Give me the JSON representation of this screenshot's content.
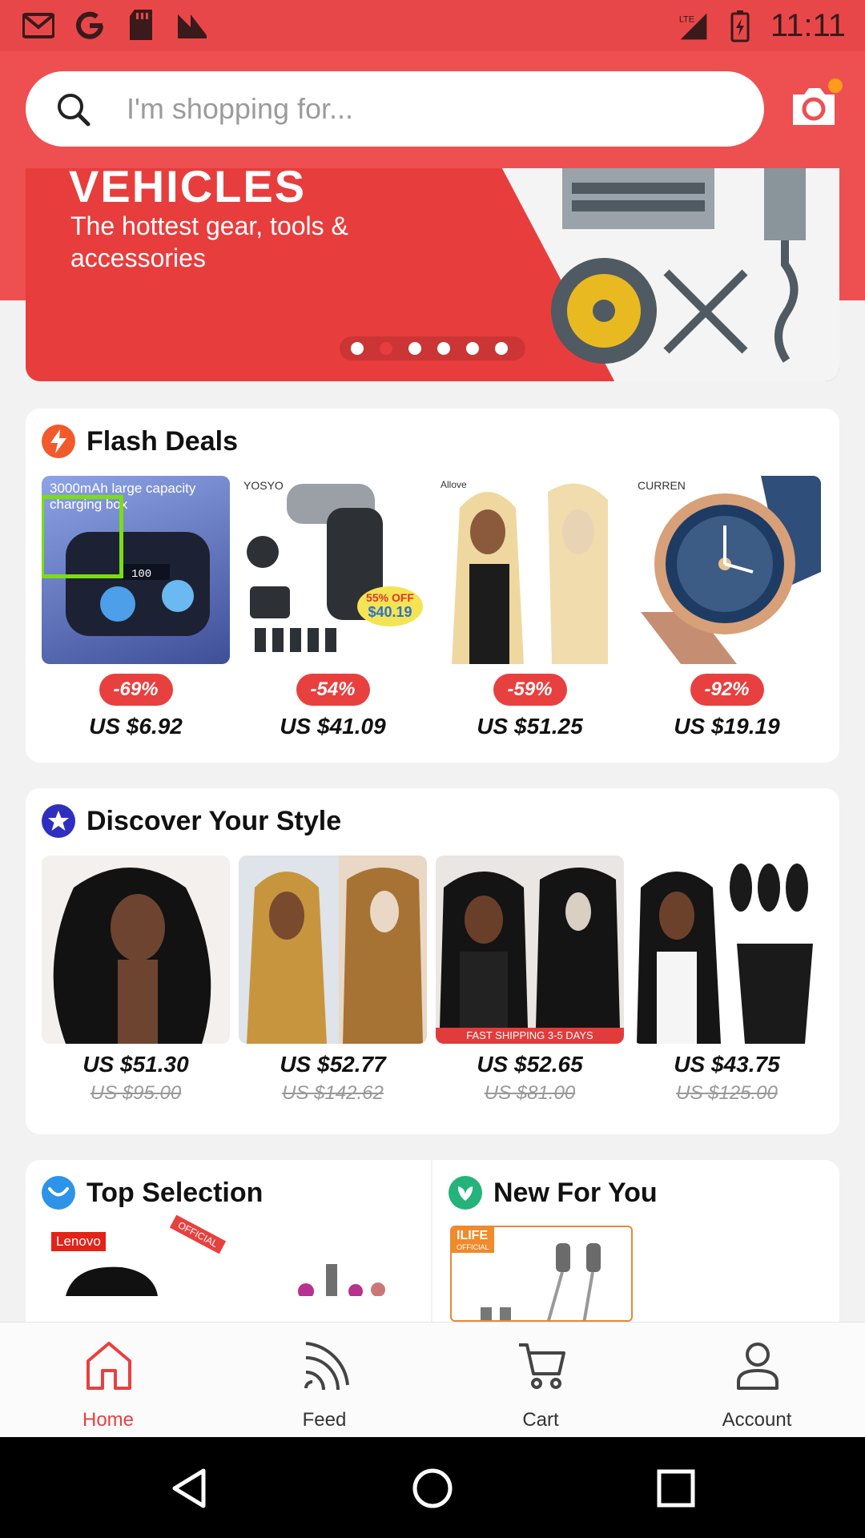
{
  "status_bar": {
    "time": "11:11",
    "network": "LTE",
    "left_icons": [
      "gmail-icon",
      "google-icon",
      "sd-card-icon",
      "news-icon"
    ]
  },
  "search": {
    "placeholder": "I'm shopping for..."
  },
  "banner": {
    "title": "VEHICLES",
    "subtitle": "The hottest gear, tools & accessories",
    "dots": 6,
    "active_dot": 1
  },
  "flash_deals": {
    "title": "Flash Deals",
    "products": [
      {
        "discount": "-69%",
        "price": "US $6.92",
        "caption": "3000mAh large capacity charging box"
      },
      {
        "discount": "-54%",
        "price": "US $41.09",
        "brand": "YOSYO",
        "tag_off": "55% OFF",
        "tag_price": "$40.19"
      },
      {
        "discount": "-59%",
        "price": "US $51.25",
        "brand": "Allove"
      },
      {
        "discount": "-92%",
        "price": "US $19.19",
        "brand": "CURREN"
      }
    ]
  },
  "discover": {
    "title": "Discover Your Style",
    "products": [
      {
        "price": "US $51.30",
        "old_price": "US $95.00"
      },
      {
        "price": "US $52.77",
        "old_price": "US $142.62"
      },
      {
        "price": "US $52.65",
        "old_price": "US $81.00",
        "banner_text": "FAST SHIPPING 3-5 DAYS"
      },
      {
        "price": "US $43.75",
        "old_price": "US $125.00"
      }
    ]
  },
  "top_selection": {
    "title": "Top Selection",
    "brand": "Lenovo",
    "tag": "OFFICIAL"
  },
  "new_for_you": {
    "title": "New For You",
    "brand": "ILIFE",
    "tag": "OFFICIAL"
  },
  "bottom_nav": {
    "items": [
      {
        "label": "Home",
        "icon": "home-icon",
        "active": true
      },
      {
        "label": "Feed",
        "icon": "feed-icon",
        "active": false
      },
      {
        "label": "Cart",
        "icon": "cart-icon",
        "active": false
      },
      {
        "label": "Account",
        "icon": "account-icon",
        "active": false
      }
    ]
  },
  "colors": {
    "brand": "#ee4f51",
    "badge": "#e8403f",
    "active_nav": "#e8403f"
  }
}
